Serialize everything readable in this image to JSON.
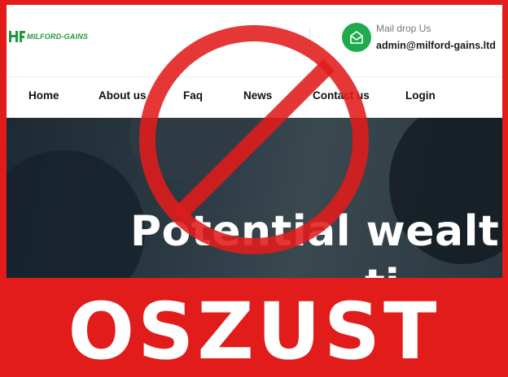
{
  "header": {
    "logo_text": "MILFORD-GAINS",
    "mail_label": "Mail drop Us",
    "mail_value": "admin@milford-gains.ltd"
  },
  "nav": {
    "items": [
      "Home",
      "About us",
      "Faq",
      "News",
      "Contact us",
      "Login"
    ]
  },
  "hero": {
    "title": "Potential wealt",
    "title_line2": "ti"
  },
  "banner": {
    "text": "OSZUST"
  },
  "colors": {
    "warning_red": "#e21b1b",
    "brand_green": "#1eab4c"
  },
  "icons": {
    "mail": "mail-icon",
    "prohibition": "prohibition-sign-icon"
  }
}
